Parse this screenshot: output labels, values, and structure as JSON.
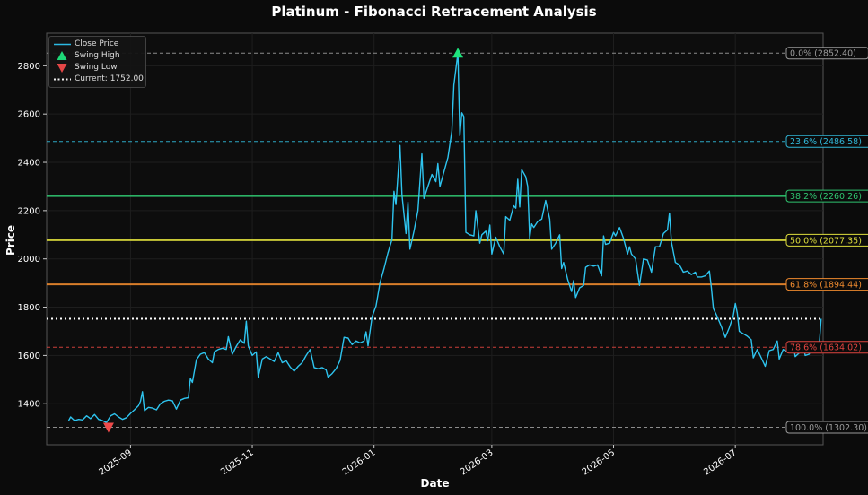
{
  "chart_data": {
    "type": "line",
    "title": "Platinum - Fibonacci Retracement Analysis",
    "xlabel": "Date",
    "ylabel": "Price",
    "xlim": [
      "2025-07-21",
      "2026-08-14"
    ],
    "ylim": [
      1230,
      2935
    ],
    "x_ticks": [
      "2025-09",
      "2025-11",
      "2026-01",
      "2026-03",
      "2026-05",
      "2026-07"
    ],
    "x_tick_dates": [
      "2025-09-01",
      "2025-11-01",
      "2026-01-01",
      "2026-03-01",
      "2026-05-01",
      "2026-07-01"
    ],
    "y_ticks": [
      1400,
      1600,
      1800,
      2000,
      2200,
      2400,
      2600,
      2800
    ],
    "legend": {
      "position": "top-left",
      "entries": [
        "Close Price",
        "Swing High",
        "Swing Low",
        "Current: 1752.00"
      ]
    },
    "grid": true,
    "series": [
      {
        "name": "Close Price",
        "color": "#2ec4ef",
        "points": [
          [
            "2025-08-01",
            1330
          ],
          [
            "2025-08-02",
            1345
          ],
          [
            "2025-08-04",
            1330
          ],
          [
            "2025-08-06",
            1335
          ],
          [
            "2025-08-08",
            1333
          ],
          [
            "2025-08-10",
            1350
          ],
          [
            "2025-08-12",
            1338
          ],
          [
            "2025-08-14",
            1355
          ],
          [
            "2025-08-16",
            1335
          ],
          [
            "2025-08-18",
            1330
          ],
          [
            "2025-08-20",
            1322
          ],
          [
            "2025-08-22",
            1350
          ],
          [
            "2025-08-24",
            1358
          ],
          [
            "2025-08-26",
            1345
          ],
          [
            "2025-08-28",
            1335
          ],
          [
            "2025-08-30",
            1342
          ],
          [
            "2025-09-01",
            1360
          ],
          [
            "2025-09-03",
            1375
          ],
          [
            "2025-09-05",
            1392
          ],
          [
            "2025-09-06",
            1410
          ],
          [
            "2025-09-07",
            1450
          ],
          [
            "2025-09-08",
            1372
          ],
          [
            "2025-09-10",
            1385
          ],
          [
            "2025-09-12",
            1382
          ],
          [
            "2025-09-14",
            1375
          ],
          [
            "2025-09-16",
            1400
          ],
          [
            "2025-09-18",
            1410
          ],
          [
            "2025-09-20",
            1415
          ],
          [
            "2025-09-22",
            1412
          ],
          [
            "2025-09-24",
            1378
          ],
          [
            "2025-09-26",
            1415
          ],
          [
            "2025-09-28",
            1422
          ],
          [
            "2025-09-30",
            1425
          ],
          [
            "2025-10-01",
            1505
          ],
          [
            "2025-10-02",
            1488
          ],
          [
            "2025-10-04",
            1582
          ],
          [
            "2025-10-06",
            1605
          ],
          [
            "2025-10-08",
            1612
          ],
          [
            "2025-10-10",
            1585
          ],
          [
            "2025-10-12",
            1570
          ],
          [
            "2025-10-13",
            1615
          ],
          [
            "2025-10-15",
            1625
          ],
          [
            "2025-10-17",
            1630
          ],
          [
            "2025-10-19",
            1625
          ],
          [
            "2025-10-20",
            1678
          ],
          [
            "2025-10-22",
            1605
          ],
          [
            "2025-10-24",
            1638
          ],
          [
            "2025-10-26",
            1665
          ],
          [
            "2025-10-28",
            1650
          ],
          [
            "2025-10-29",
            1742
          ],
          [
            "2025-10-30",
            1640
          ],
          [
            "2025-11-01",
            1600
          ],
          [
            "2025-11-03",
            1615
          ],
          [
            "2025-11-04",
            1510
          ],
          [
            "2025-11-06",
            1585
          ],
          [
            "2025-11-08",
            1595
          ],
          [
            "2025-11-10",
            1585
          ],
          [
            "2025-11-12",
            1575
          ],
          [
            "2025-11-14",
            1612
          ],
          [
            "2025-11-16",
            1570
          ],
          [
            "2025-11-18",
            1578
          ],
          [
            "2025-11-20",
            1552
          ],
          [
            "2025-11-22",
            1535
          ],
          [
            "2025-11-24",
            1555
          ],
          [
            "2025-11-26",
            1570
          ],
          [
            "2025-11-28",
            1600
          ],
          [
            "2025-11-30",
            1625
          ],
          [
            "2025-12-02",
            1550
          ],
          [
            "2025-12-04",
            1545
          ],
          [
            "2025-12-06",
            1550
          ],
          [
            "2025-12-08",
            1540
          ],
          [
            "2025-12-09",
            1510
          ],
          [
            "2025-12-11",
            1525
          ],
          [
            "2025-12-13",
            1545
          ],
          [
            "2025-12-15",
            1580
          ],
          [
            "2025-12-17",
            1675
          ],
          [
            "2025-12-19",
            1672
          ],
          [
            "2025-12-21",
            1645
          ],
          [
            "2025-12-23",
            1660
          ],
          [
            "2025-12-25",
            1652
          ],
          [
            "2025-12-27",
            1660
          ],
          [
            "2025-12-28",
            1698
          ],
          [
            "2025-12-29",
            1640
          ],
          [
            "2025-12-31",
            1760
          ],
          [
            "2026-01-02",
            1805
          ],
          [
            "2026-01-04",
            1900
          ],
          [
            "2026-01-06",
            1960
          ],
          [
            "2026-01-08",
            2025
          ],
          [
            "2026-01-10",
            2080
          ],
          [
            "2026-01-11",
            2280
          ],
          [
            "2026-01-12",
            2225
          ],
          [
            "2026-01-14",
            2470
          ],
          [
            "2026-01-15",
            2265
          ],
          [
            "2026-01-17",
            2105
          ],
          [
            "2026-01-18",
            2235
          ],
          [
            "2026-01-19",
            2040
          ],
          [
            "2026-01-21",
            2115
          ],
          [
            "2026-01-23",
            2200
          ],
          [
            "2026-01-25",
            2435
          ],
          [
            "2026-01-26",
            2250
          ],
          [
            "2026-01-28",
            2300
          ],
          [
            "2026-01-30",
            2350
          ],
          [
            "2026-02-01",
            2320
          ],
          [
            "2026-02-02",
            2395
          ],
          [
            "2026-02-03",
            2300
          ],
          [
            "2026-02-05",
            2360
          ],
          [
            "2026-02-07",
            2420
          ],
          [
            "2026-02-09",
            2530
          ],
          [
            "2026-02-10",
            2720
          ],
          [
            "2026-02-12",
            2852.4
          ],
          [
            "2026-02-13",
            2510
          ],
          [
            "2026-02-14",
            2605
          ],
          [
            "2026-02-15",
            2590
          ],
          [
            "2026-02-16",
            2110
          ],
          [
            "2026-02-18",
            2100
          ],
          [
            "2026-02-20",
            2095
          ],
          [
            "2026-02-21",
            2200
          ],
          [
            "2026-02-23",
            2065
          ],
          [
            "2026-02-24",
            2100
          ],
          [
            "2026-02-26",
            2115
          ],
          [
            "2026-02-27",
            2075
          ],
          [
            "2026-02-28",
            2140
          ],
          [
            "2026-03-01",
            2020
          ],
          [
            "2026-03-03",
            2090
          ],
          [
            "2026-03-05",
            2050
          ],
          [
            "2026-03-07",
            2020
          ],
          [
            "2026-03-08",
            2175
          ],
          [
            "2026-03-10",
            2160
          ],
          [
            "2026-03-12",
            2220
          ],
          [
            "2026-03-13",
            2210
          ],
          [
            "2026-03-14",
            2330
          ],
          [
            "2026-03-15",
            2215
          ],
          [
            "2026-03-16",
            2370
          ],
          [
            "2026-03-18",
            2340
          ],
          [
            "2026-03-19",
            2300
          ],
          [
            "2026-03-20",
            2085
          ],
          [
            "2026-03-21",
            2145
          ],
          [
            "2026-03-22",
            2130
          ],
          [
            "2026-03-24",
            2155
          ],
          [
            "2026-03-26",
            2165
          ],
          [
            "2026-03-28",
            2242
          ],
          [
            "2026-03-30",
            2165
          ],
          [
            "2026-03-31",
            2040
          ],
          [
            "2026-04-02",
            2065
          ],
          [
            "2026-04-04",
            2100
          ],
          [
            "2026-04-05",
            1960
          ],
          [
            "2026-04-06",
            1985
          ],
          [
            "2026-04-08",
            1915
          ],
          [
            "2026-04-10",
            1865
          ],
          [
            "2026-04-11",
            1910
          ],
          [
            "2026-04-12",
            1840
          ],
          [
            "2026-04-14",
            1880
          ],
          [
            "2026-04-16",
            1890
          ],
          [
            "2026-04-17",
            1965
          ],
          [
            "2026-04-19",
            1975
          ],
          [
            "2026-04-21",
            1970
          ],
          [
            "2026-04-23",
            1975
          ],
          [
            "2026-04-25",
            1930
          ],
          [
            "2026-04-26",
            2095
          ],
          [
            "2026-04-27",
            2060
          ],
          [
            "2026-04-29",
            2065
          ],
          [
            "2026-05-01",
            2110
          ],
          [
            "2026-05-02",
            2095
          ],
          [
            "2026-05-04",
            2130
          ],
          [
            "2026-05-06",
            2085
          ],
          [
            "2026-05-08",
            2020
          ],
          [
            "2026-05-09",
            2050
          ],
          [
            "2026-05-10",
            2020
          ],
          [
            "2026-05-12",
            2000
          ],
          [
            "2026-05-13",
            1945
          ],
          [
            "2026-05-14",
            1890
          ],
          [
            "2026-05-16",
            2000
          ],
          [
            "2026-05-18",
            1995
          ],
          [
            "2026-05-20",
            1945
          ],
          [
            "2026-05-22",
            2050
          ],
          [
            "2026-05-24",
            2050
          ],
          [
            "2026-05-26",
            2105
          ],
          [
            "2026-05-28",
            2120
          ],
          [
            "2026-05-29",
            2190
          ],
          [
            "2026-05-30",
            2070
          ],
          [
            "2026-06-01",
            1985
          ],
          [
            "2026-06-03",
            1975
          ],
          [
            "2026-06-05",
            1945
          ],
          [
            "2026-06-07",
            1950
          ],
          [
            "2026-06-09",
            1935
          ],
          [
            "2026-06-11",
            1945
          ],
          [
            "2026-06-12",
            1925
          ],
          [
            "2026-06-14",
            1925
          ],
          [
            "2026-06-16",
            1930
          ],
          [
            "2026-06-18",
            1950
          ],
          [
            "2026-06-19",
            1880
          ],
          [
            "2026-06-20",
            1795
          ],
          [
            "2026-06-22",
            1760
          ],
          [
            "2026-06-24",
            1720
          ],
          [
            "2026-06-26",
            1675
          ],
          [
            "2026-06-28",
            1715
          ],
          [
            "2026-06-30",
            1765
          ],
          [
            "2026-07-01",
            1815
          ],
          [
            "2026-07-02",
            1775
          ],
          [
            "2026-07-03",
            1700
          ],
          [
            "2026-07-05",
            1690
          ],
          [
            "2026-07-07",
            1680
          ],
          [
            "2026-07-09",
            1665
          ],
          [
            "2026-07-10",
            1590
          ],
          [
            "2026-07-12",
            1625
          ],
          [
            "2026-07-14",
            1590
          ],
          [
            "2026-07-16",
            1555
          ],
          [
            "2026-07-18",
            1620
          ],
          [
            "2026-07-20",
            1625
          ],
          [
            "2026-07-22",
            1660
          ],
          [
            "2026-07-23",
            1585
          ],
          [
            "2026-07-25",
            1625
          ],
          [
            "2026-07-27",
            1615
          ],
          [
            "2026-07-29",
            1620
          ],
          [
            "2026-07-30",
            1655
          ],
          [
            "2026-07-31",
            1595
          ],
          [
            "2026-08-02",
            1610
          ],
          [
            "2026-08-04",
            1648
          ],
          [
            "2026-08-05",
            1600
          ],
          [
            "2026-08-07",
            1605
          ],
          [
            "2026-08-08",
            1625
          ],
          [
            "2026-08-09",
            1612
          ],
          [
            "2026-08-10",
            1655
          ],
          [
            "2026-08-11",
            1650
          ],
          [
            "2026-08-12",
            1640
          ],
          [
            "2026-08-13",
            1752
          ]
        ]
      }
    ],
    "swing_high": {
      "date": "2026-02-12",
      "value": 2852.4,
      "color": "#1ee37d"
    },
    "swing_low": {
      "date": "2025-08-21",
      "value": 1302.3,
      "color": "#ef4a4a"
    },
    "current": {
      "value": 1752.0,
      "color": "#ffffff"
    },
    "fib_levels": [
      {
        "label": "0.0% (2852.40)",
        "value": 2852.4,
        "color": "#9a9a9a",
        "style": "dashed"
      },
      {
        "label": "23.6% (2486.58)",
        "value": 2486.58,
        "color": "#31b7d8",
        "style": "dashed"
      },
      {
        "label": "38.2% (2260.26)",
        "value": 2260.26,
        "color": "#2fc46f",
        "style": "solid"
      },
      {
        "label": "50.0% (2077.35)",
        "value": 2077.35,
        "color": "#dede3c",
        "style": "solid"
      },
      {
        "label": "61.8% (1894.44)",
        "value": 1894.44,
        "color": "#ef8a2e",
        "style": "solid"
      },
      {
        "label": "78.6% (1634.02)",
        "value": 1634.02,
        "color": "#e0443f",
        "style": "dashed"
      },
      {
        "label": "100.0% (1302.30)",
        "value": 1302.3,
        "color": "#9a9a9a",
        "style": "dashed"
      }
    ]
  }
}
